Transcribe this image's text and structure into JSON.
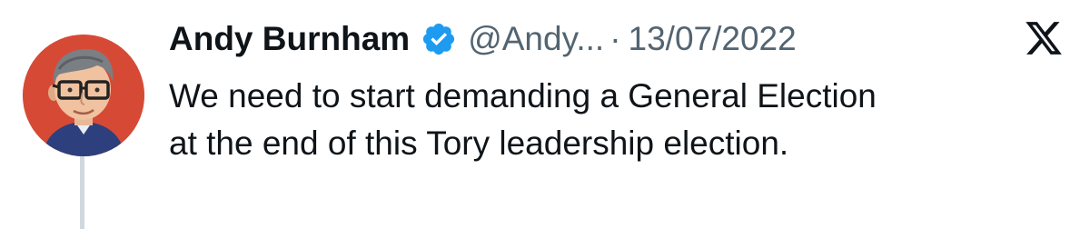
{
  "tweet": {
    "author_name": "Andy Burnham",
    "handle": "@Andy...",
    "separator": "·",
    "date": "13/07/2022",
    "text_lines": [
      "We need to start demanding a General Election",
      "at the end of this Tory leadership election."
    ]
  },
  "icons": {
    "verified": "verified-badge-icon",
    "platform": "x-logo-icon",
    "avatar": "cartoon-avatar"
  },
  "colors": {
    "name_text": "#0f1419",
    "meta_text": "#536471",
    "verified_blue": "#1d9bf0",
    "avatar_background": "#d64a35",
    "thread_line": "#cfd9de"
  }
}
